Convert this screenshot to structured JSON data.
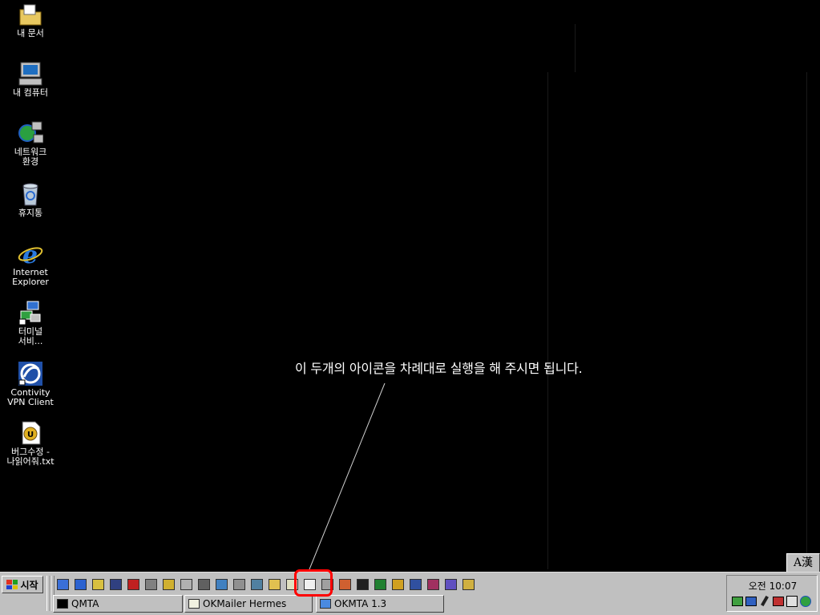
{
  "desktop": {
    "icons": [
      {
        "name": "my-documents-icon",
        "label": "내 문서",
        "label2": ""
      },
      {
        "name": "my-computer-icon",
        "label": "내 컴퓨터",
        "label2": ""
      },
      {
        "name": "network-icon",
        "label": "네트워크",
        "label2": "환경"
      },
      {
        "name": "recycle-bin-icon",
        "label": "휴지통",
        "label2": ""
      },
      {
        "name": "internet-explorer-icon",
        "label": "Internet",
        "label2": "Explorer"
      },
      {
        "name": "terminal-services-icon",
        "label": "터미널",
        "label2": "서비..."
      },
      {
        "name": "contivity-vpn-icon",
        "label": "Contivity",
        "label2": "VPN Client"
      },
      {
        "name": "text-file-icon",
        "label": "버그수정 -",
        "label2": "나읽어줘.txt"
      }
    ]
  },
  "annotation": {
    "text": "이 두개의 아이콘을 차례대로 실행을 해 주시면 됩니다."
  },
  "ime": {
    "label": "A漢"
  },
  "taskbar": {
    "start_label": "시작",
    "quick_launch": [
      {
        "name": "show-desktop-icon",
        "color": "#3a6fd8"
      },
      {
        "name": "ie-quick-icon",
        "color": "#2b62d0"
      },
      {
        "name": "outlook-quick-icon",
        "color": "#d8c040"
      },
      {
        "name": "app-quick-icon-4",
        "color": "#304080"
      },
      {
        "name": "app-quick-icon-5",
        "color": "#c02020"
      },
      {
        "name": "app-quick-icon-6",
        "color": "#808080"
      },
      {
        "name": "search-quick-icon",
        "color": "#d0b030"
      },
      {
        "name": "home-quick-icon",
        "color": "#b0b0b0"
      },
      {
        "name": "app-quick-icon-9",
        "color": "#606060"
      },
      {
        "name": "app-quick-icon-10",
        "color": "#4080c0"
      },
      {
        "name": "settings-quick-icon",
        "color": "#909090"
      },
      {
        "name": "app-quick-icon-12",
        "color": "#5080a0"
      },
      {
        "name": "folder-quick-icon",
        "color": "#e0c050"
      },
      {
        "name": "okmailer-quick-icon",
        "color": "#e0e0c0"
      },
      {
        "name": "okmta-quick-icon",
        "color": "#f0f0f0"
      },
      {
        "name": "home2-quick-icon",
        "color": "#a0a0a0"
      },
      {
        "name": "image-quick-icon",
        "color": "#d06030"
      },
      {
        "name": "console-quick-icon",
        "color": "#202020"
      },
      {
        "name": "gem-quick-icon",
        "color": "#208030"
      },
      {
        "name": "ultraedit-quick-icon",
        "color": "#d0a020"
      },
      {
        "name": "monitor-quick-icon",
        "color": "#3050a0"
      },
      {
        "name": "app-quick-icon-22",
        "color": "#a03060"
      },
      {
        "name": "app-quick-icon-23",
        "color": "#6050c0"
      },
      {
        "name": "app-quick-icon-24",
        "color": "#d0b040"
      }
    ],
    "tasks": [
      {
        "name": "task-qmta",
        "label": "QMTA"
      },
      {
        "name": "task-okmailer-hermes",
        "label": "OKMailer Hermes"
      },
      {
        "name": "task-okmta",
        "label": "OKMTA 1.3"
      }
    ],
    "clock": "오전 10:07"
  }
}
